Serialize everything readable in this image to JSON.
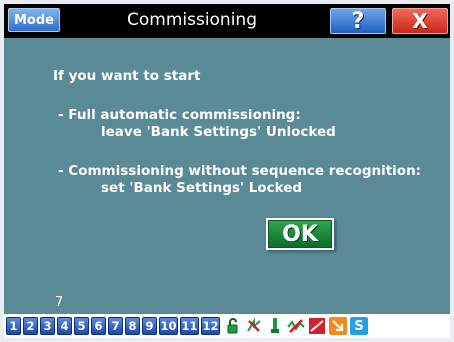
{
  "titlebar": {
    "mode_label": "Mode",
    "title": "Commissioning",
    "help_label": "?",
    "close_label": "X"
  },
  "message": {
    "line1": "If you want to start",
    "line2": "- Full automatic commissioning:",
    "line3": "leave 'Bank Settings' Unlocked",
    "line4": "- Commissioning without sequence recognition:",
    "line5": "set 'Bank Settings' Locked"
  },
  "ok_label": "OK",
  "page_number": "7",
  "bottombar": {
    "numbers": [
      "1",
      "2",
      "3",
      "4",
      "5",
      "6",
      "7",
      "8",
      "9",
      "10",
      "11",
      "12"
    ],
    "icons": [
      "lock-open-icon",
      "lightning-icon",
      "probe-icon",
      "waveform-icon",
      "chart-icon",
      "arrow-icon",
      "s-icon"
    ],
    "s_label": "S"
  },
  "colors": {
    "panel": "#5a8a96",
    "titlebar": "#000000",
    "ok_button": "#1c8a3a",
    "mode_button": "#4a8ee0",
    "close_button": "#e0392b"
  }
}
